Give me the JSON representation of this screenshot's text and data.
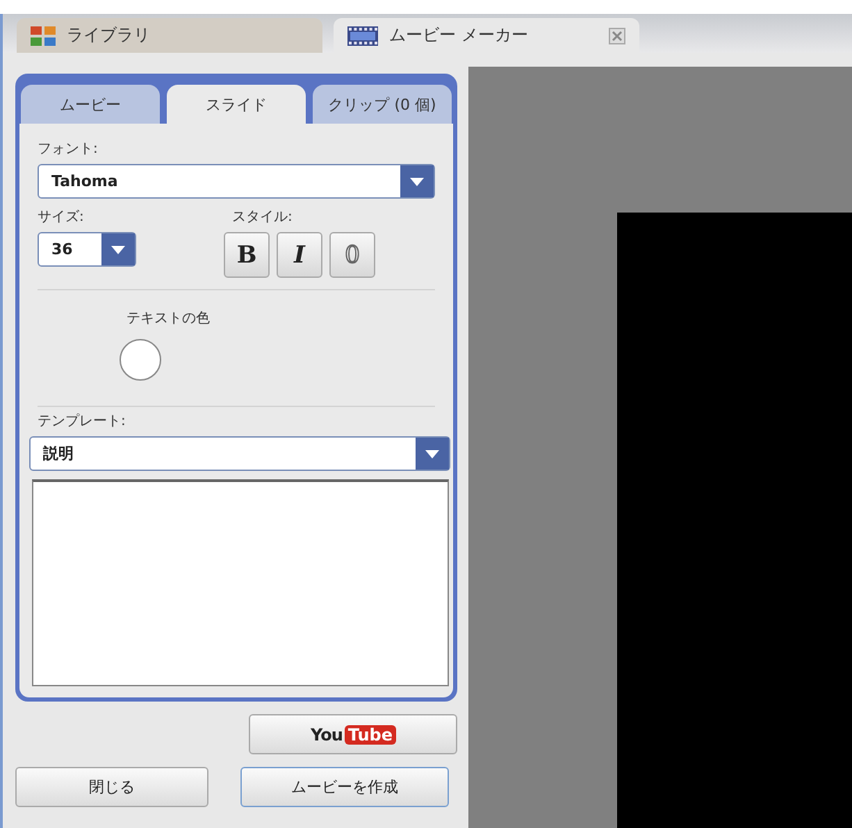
{
  "doc_tabs": [
    {
      "label": "ライブラリ",
      "kind": "grid",
      "selected": false,
      "closable": false
    },
    {
      "label": "ムービー メーカー",
      "kind": "film",
      "selected": true,
      "closable": true
    }
  ],
  "panel_tabs": [
    {
      "label": "ムービー",
      "selected": false
    },
    {
      "label": "スライド",
      "selected": true
    },
    {
      "label": "クリップ (0 個)",
      "selected": false
    }
  ],
  "font": {
    "label": "フォント:",
    "value": "Tahoma"
  },
  "size": {
    "label": "サイズ:",
    "value": "36"
  },
  "style": {
    "label": "スタイル:",
    "buttons": [
      {
        "kind": "bold",
        "label": "B"
      },
      {
        "kind": "italic",
        "label": "I"
      },
      {
        "kind": "outline",
        "label": "0"
      }
    ]
  },
  "text_color": {
    "label": "テキストの色",
    "color": "#ffffff"
  },
  "template": {
    "label": "テンプレート:",
    "value": "説明"
  },
  "youtube_button": {
    "word_1": "You",
    "word_2": "Tube"
  },
  "buttons": [
    {
      "label": "閉じる",
      "primary": false
    },
    {
      "label": "ムービーを作成",
      "primary": true
    }
  ]
}
